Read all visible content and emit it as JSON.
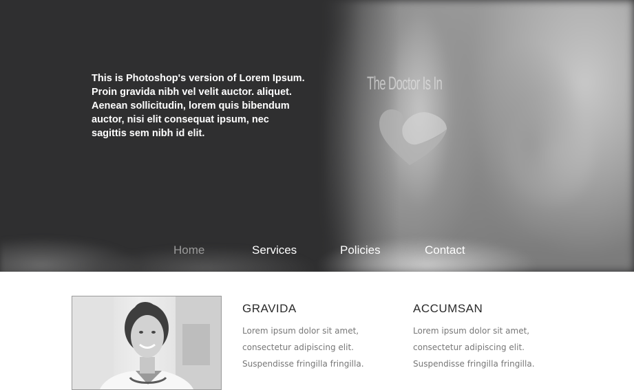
{
  "hero": {
    "intro_text": "This is Photoshop's version of Lorem Ipsum. Proin gravida nibh vel velit auctor. aliquet. Aenean sollicitudin, lorem quis bibendum auctor, nisi elit consequat ipsum, nec sagittis sem nibh id elit.",
    "brand_title": "The Doctor Is In",
    "brand_icon": "heart-icon"
  },
  "nav": {
    "items": [
      {
        "label": "Home",
        "active": true
      },
      {
        "label": "Services",
        "active": false
      },
      {
        "label": "Policies",
        "active": false
      },
      {
        "label": "Contact",
        "active": false
      }
    ]
  },
  "content": {
    "columns": [
      {
        "heading": "GRAVIDA",
        "lines": [
          "Lorem ipsum dolor sit amet,",
          "consectetur adipiscing elit.",
          "Suspendisse fringilla fringilla."
        ]
      },
      {
        "heading": "ACCUMSAN",
        "lines": [
          "Lorem ipsum dolor sit amet,",
          "consectetur adipiscing elit.",
          "Suspendisse fringilla fringilla."
        ]
      }
    ]
  },
  "colors": {
    "hero_dark": "#2f2f30",
    "nav_active": "#9a9a9a",
    "body_text": "#777777"
  }
}
